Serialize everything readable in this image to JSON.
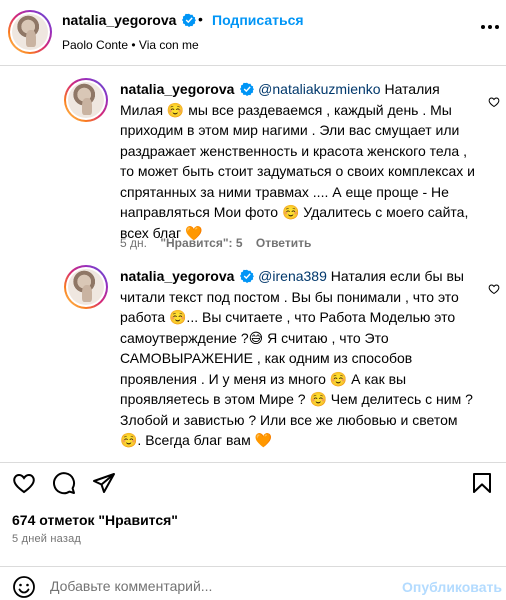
{
  "header": {
    "username": "natalia_yegorova",
    "separator": "•",
    "follow_label": "Подписаться",
    "audio_line": "Paolo Conte • Via con me"
  },
  "comments": [
    {
      "username": "natalia_yegorova",
      "mention": "@nataliakuzmienko",
      "text": " Наталия Милая ☺️ мы все раздеваемся , каждый день . Мы приходим в этом мир нагими . Эли вас смущает или раздражает женственность и красота женского тела , то может быть стоит задуматься о своих комплексах и спрятанных за ними травмах .... А еще проще - Не направляться Мои фото ☺️ Удалитесь с моего сайта, всех благ 🧡",
      "age": "5 дн.",
      "likes_label": "\"Нравится\": 5",
      "reply_label": "Ответить"
    },
    {
      "username": "natalia_yegorova",
      "mention": "@irena389",
      "text": " Наталия если бы вы читали текст под постом . Вы бы понимали , что это работа ☺️... Вы считаете , что Работа Моделью это самоутверждение ?😅 Я считаю , что Это САМОВЫРАЖЕНИЕ , как одним из способов проявления . И у меня из много ☺️ А как вы проявляетесь в этом Мире ? ☺️ Чем делитесь с ним ? Злобой и завистью ? Или все же любовью и светом ☺️. Всегда благ вам 🧡"
    }
  ],
  "post": {
    "likes_text": "674 отметок \"Нравится\"",
    "posted_ago": "5 дней назад"
  },
  "add_comment": {
    "placeholder": "Добавьте комментарий...",
    "publish_label": "Опубликовать"
  },
  "colors": {
    "accent": "#0095f6",
    "mention": "#00376b",
    "muted": "#737373",
    "publish_disabled": "#b3dbff"
  },
  "icons": [
    "verified-badge-icon",
    "more-options-icon",
    "heart-icon",
    "comment-icon",
    "share-icon",
    "bookmark-icon",
    "emoji-icon"
  ]
}
